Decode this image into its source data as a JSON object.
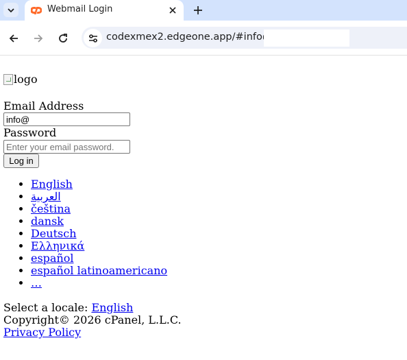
{
  "browser": {
    "tab_title": "Webmail Login",
    "url": "codexmex2.edgeone.app/#info@"
  },
  "page": {
    "logo_alt": "logo",
    "email_label": "Email Address",
    "email_value": "info@",
    "password_label": "Password",
    "password_placeholder": "Enter your email password.",
    "login_button": "Log in",
    "locales": [
      "English",
      "العربية",
      "čeština",
      "dansk",
      "Deutsch",
      "Ελληνικά",
      "español",
      "español latinoamericano",
      "…"
    ],
    "select_locale_label": "Select a locale:",
    "selected_locale": "English",
    "copyright": "Copyright© 2026 cPanel, L.L.C.",
    "privacy_link": "Privacy Policy"
  },
  "colors": {
    "tabstrip": "#d3e3fd",
    "link": "#0000ee",
    "favicon": "#ff6c2c"
  }
}
